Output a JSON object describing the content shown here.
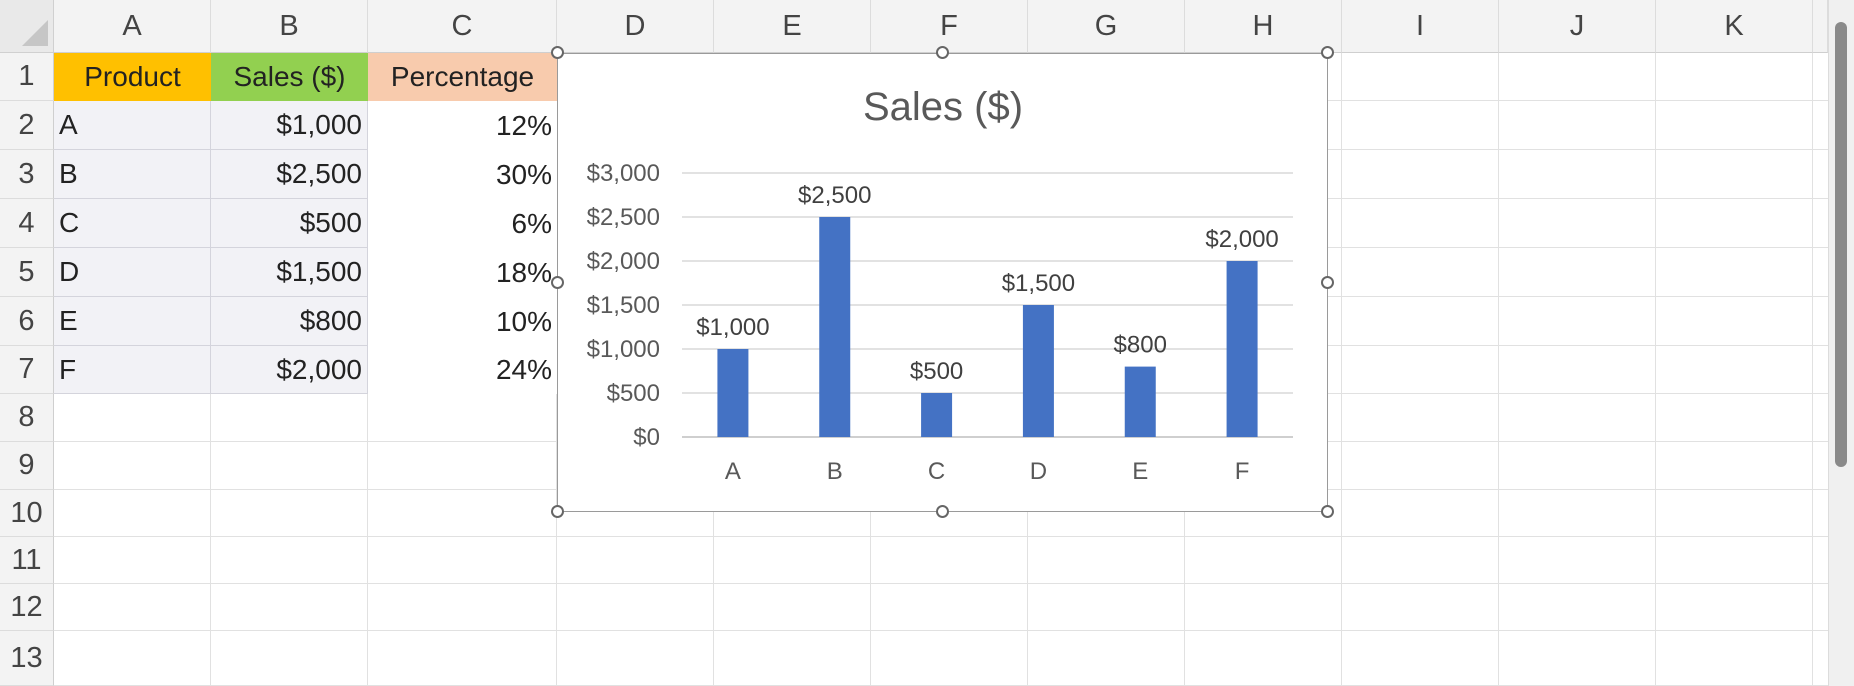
{
  "columns": [
    "A",
    "B",
    "C",
    "D",
    "E",
    "F",
    "G",
    "H",
    "I",
    "J",
    "K"
  ],
  "rows": [
    "1",
    "2",
    "3",
    "4",
    "5",
    "6",
    "7",
    "8",
    "9",
    "10",
    "11",
    "12",
    "13"
  ],
  "table": {
    "headers": [
      "Product",
      "Sales ($)",
      "Percentage"
    ],
    "header_colors": [
      "#FFC000",
      "#92D050",
      "#F8CBAD"
    ],
    "rows": [
      {
        "product": "A",
        "sales": "$1,000",
        "pct": "12%"
      },
      {
        "product": "B",
        "sales": "$2,500",
        "pct": "30%"
      },
      {
        "product": "C",
        "sales": "$500",
        "pct": "6%"
      },
      {
        "product": "D",
        "sales": "$1,500",
        "pct": "18%"
      },
      {
        "product": "E",
        "sales": "$800",
        "pct": "10%"
      },
      {
        "product": "F",
        "sales": "$2,000",
        "pct": "24%"
      }
    ]
  },
  "chart_data": {
    "type": "bar",
    "title": "Sales ($)",
    "categories": [
      "A",
      "B",
      "C",
      "D",
      "E",
      "F"
    ],
    "values": [
      1000,
      2500,
      500,
      1500,
      800,
      2000
    ],
    "data_labels": [
      "$1,000",
      "$2,500",
      "$500",
      "$1,500",
      "$800",
      "$2,000"
    ],
    "yticks": [
      0,
      500,
      1000,
      1500,
      2000,
      2500,
      3000
    ],
    "ytick_labels": [
      "$0",
      "$500",
      "$1,000",
      "$1,500",
      "$2,000",
      "$2,500",
      "$3,000"
    ],
    "ylim": [
      0,
      3000
    ],
    "grid": true,
    "legend": "none",
    "bar_color": "#4472C4"
  }
}
